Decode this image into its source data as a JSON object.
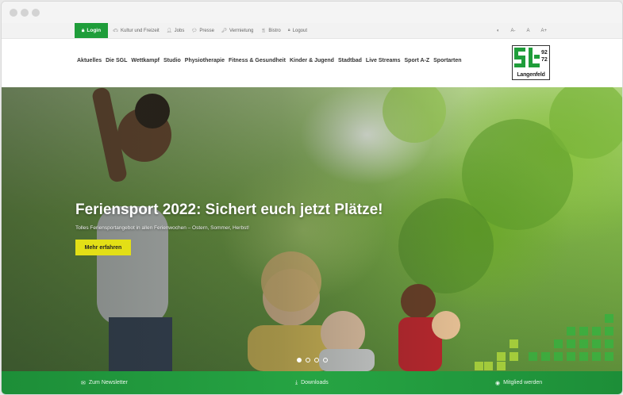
{
  "topbar": {
    "login_label": "Login",
    "links": [
      {
        "label": "Kultur und Freizeit",
        "icon": "car-icon"
      },
      {
        "label": "Jobs",
        "icon": "person-icon"
      },
      {
        "label": "Presse",
        "icon": "chat-icon"
      },
      {
        "label": "Vermietung",
        "icon": "key-icon"
      },
      {
        "label": "Bistro",
        "icon": "fork-knife-icon"
      },
      {
        "label": "Logout",
        "icon": "lock-icon"
      }
    ],
    "accessibility": {
      "contrast": "◐",
      "font_small": "A-",
      "font_normal": "A",
      "font_large": "A+"
    }
  },
  "nav": {
    "items": [
      "Aktuelles",
      "Die SGL",
      "Wettkampf",
      "Studio",
      "Physiotherapie",
      "Fitness & Gesundheit",
      "Kinder & Jugend",
      "Stadtbad",
      "Live Streams",
      "Sport A-Z",
      "Sportarten"
    ]
  },
  "logo": {
    "caption": "Langenfeld",
    "year_top": "92",
    "year_bottom": "72"
  },
  "hero": {
    "title": "Feriensport 2022: Sichert euch jetzt Plätze!",
    "subtitle": "Tolles Feriensportangebot in allen Ferienwochen – Ostern, Sommer, Herbst!",
    "button_label": "Mehr erfahren",
    "slides_total": 4,
    "slide_active": 1
  },
  "footer": {
    "newsletter_label": "Zum Newsletter",
    "downloads_label": "Downloads",
    "member_label": "Mitglied werden"
  },
  "colors": {
    "brand_green": "#1f9d3a",
    "accent_yellow": "#e3df16"
  }
}
